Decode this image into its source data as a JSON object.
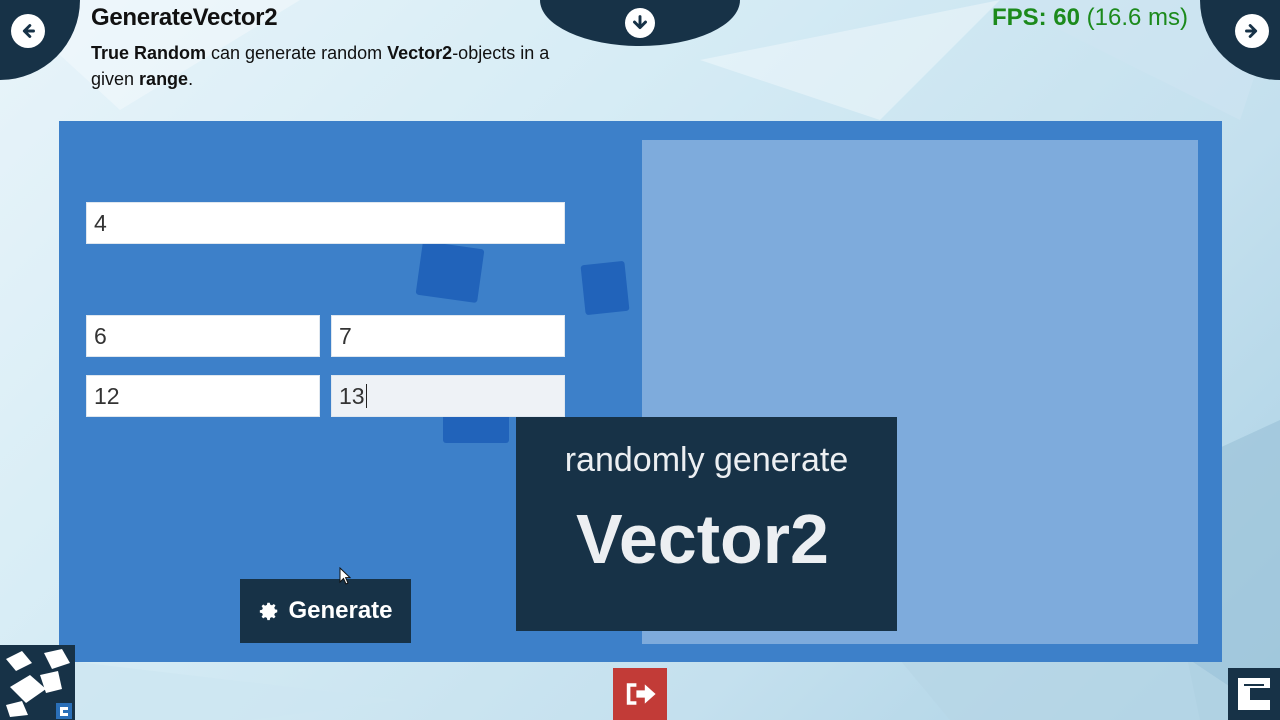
{
  "header": {
    "title": "GenerateVector2",
    "description": {
      "part1": "True Random",
      "part2": " can generate random ",
      "part3": "Vector2",
      "part4": "-objects in a given ",
      "part5": "range",
      "part6": "."
    },
    "fps": {
      "label": "FPS: 60",
      "detail": " (16.6 ms)"
    }
  },
  "nav": {
    "back_icon": "arrow-left-circle-icon",
    "forward_icon": "arrow-right-circle-icon",
    "download_icon": "arrow-down-circle-icon"
  },
  "form": {
    "count_value": "4",
    "min_x_value": "6",
    "min_y_value": "7",
    "max_x_value": "12",
    "max_y_value": "13",
    "generate_label": "Generate"
  },
  "overlay": {
    "line1": "randomly generate",
    "line2": "Vector2"
  },
  "colors": {
    "panel": "#3d80c9",
    "panel_right": "#7eabdc",
    "dark": "#173247",
    "fps_green": "#1c8a1c",
    "exit_red": "#c23b37"
  }
}
